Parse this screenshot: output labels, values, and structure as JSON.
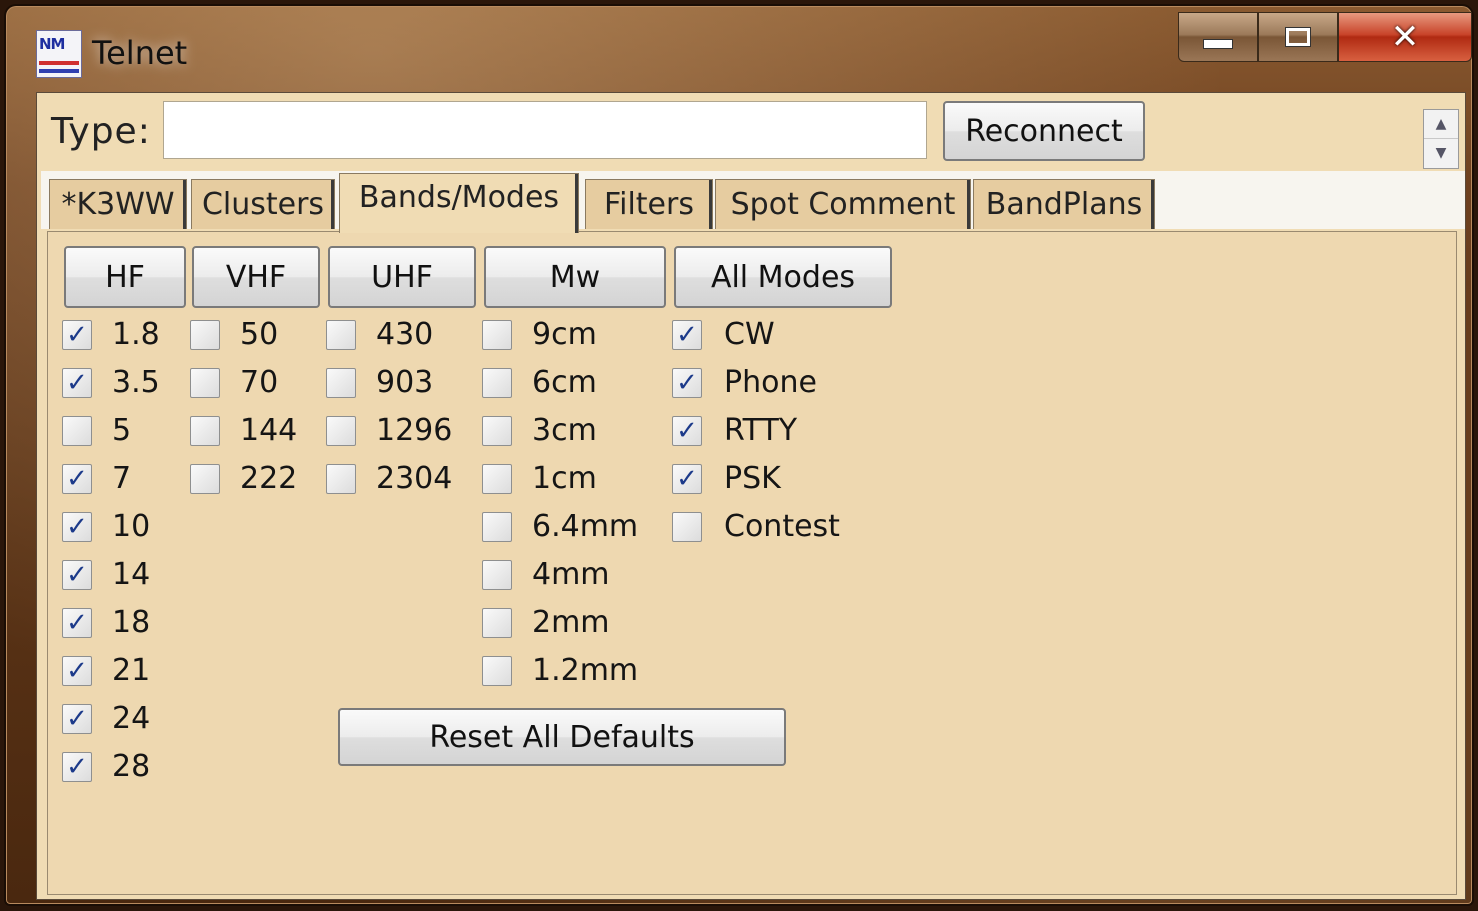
{
  "window": {
    "title": "Telnet"
  },
  "toolbar": {
    "type_label": "Type:",
    "type_value": "",
    "reconnect_label": "Reconnect"
  },
  "tabs": [
    {
      "label": "*K3WW",
      "active": false
    },
    {
      "label": "Clusters",
      "active": false
    },
    {
      "label": "Bands/Modes",
      "active": true
    },
    {
      "label": "Filters",
      "active": false
    },
    {
      "label": "Spot Comment",
      "active": false
    },
    {
      "label": "BandPlans",
      "active": false
    }
  ],
  "groups": {
    "hf": {
      "button": "HF",
      "items": [
        {
          "label": "1.8",
          "checked": true
        },
        {
          "label": "3.5",
          "checked": true
        },
        {
          "label": "5",
          "checked": false
        },
        {
          "label": "7",
          "checked": true
        },
        {
          "label": "10",
          "checked": true
        },
        {
          "label": "14",
          "checked": true
        },
        {
          "label": "18",
          "checked": true
        },
        {
          "label": "21",
          "checked": true
        },
        {
          "label": "24",
          "checked": true
        },
        {
          "label": "28",
          "checked": true
        }
      ]
    },
    "vhf": {
      "button": "VHF",
      "items": [
        {
          "label": "50",
          "checked": false
        },
        {
          "label": "70",
          "checked": false
        },
        {
          "label": "144",
          "checked": false
        },
        {
          "label": "222",
          "checked": false
        }
      ]
    },
    "uhf": {
      "button": "UHF",
      "items": [
        {
          "label": "430",
          "checked": false
        },
        {
          "label": "903",
          "checked": false
        },
        {
          "label": "1296",
          "checked": false
        },
        {
          "label": "2304",
          "checked": false
        }
      ]
    },
    "mw": {
      "button": "Mw",
      "items": [
        {
          "label": "9cm",
          "checked": false
        },
        {
          "label": "6cm",
          "checked": false
        },
        {
          "label": "3cm",
          "checked": false
        },
        {
          "label": "1cm",
          "checked": false
        },
        {
          "label": "6.4mm",
          "checked": false
        },
        {
          "label": "4mm",
          "checked": false
        },
        {
          "label": "2mm",
          "checked": false
        },
        {
          "label": "1.2mm",
          "checked": false
        }
      ]
    },
    "modes": {
      "button": "All Modes",
      "items": [
        {
          "label": "CW",
          "checked": true
        },
        {
          "label": "Phone",
          "checked": true
        },
        {
          "label": "RTTY",
          "checked": true
        },
        {
          "label": "PSK",
          "checked": true
        },
        {
          "label": "Contest",
          "checked": false
        }
      ]
    }
  },
  "reset_label": "Reset All Defaults",
  "colors": {
    "panel": "#eed8b0",
    "tab_inactive": "#e6cca0",
    "close_button": "#c8442a"
  }
}
